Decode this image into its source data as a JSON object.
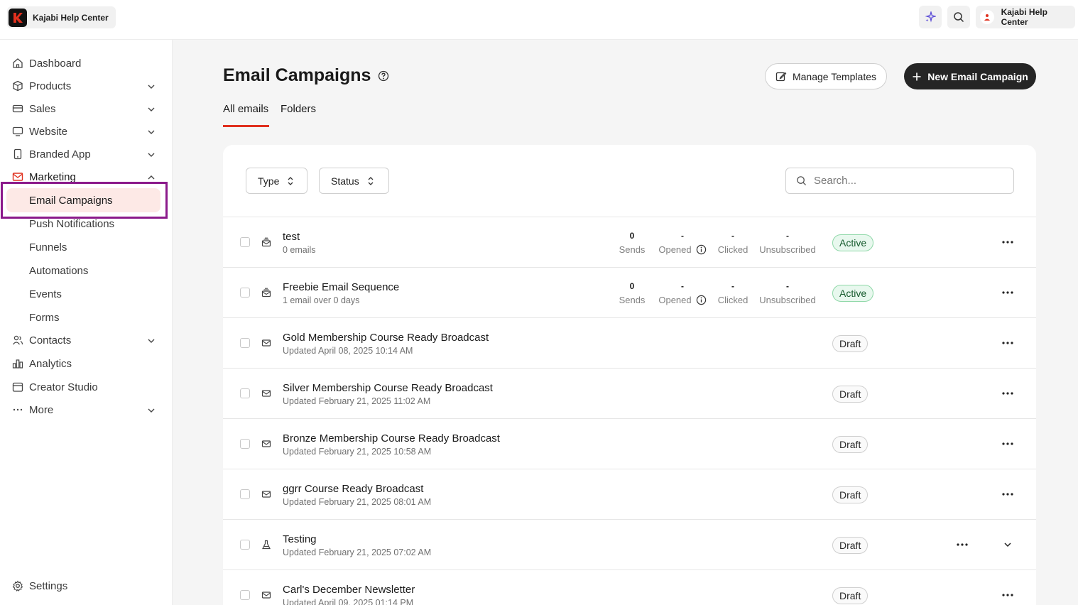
{
  "header": {
    "brand_name": "Kajabi Help Center",
    "account_name": "Kajabi Help Center",
    "icons": [
      "sparkle-icon",
      "search-icon",
      "avatar"
    ]
  },
  "sidebar": {
    "items": [
      {
        "label": "Dashboard",
        "icon": "home-icon"
      },
      {
        "label": "Products",
        "icon": "box-icon"
      },
      {
        "label": "Sales",
        "icon": "card-icon"
      },
      {
        "label": "Website",
        "icon": "monitor-icon"
      },
      {
        "label": "Branded App",
        "icon": "phone-icon"
      },
      {
        "label": "Marketing",
        "icon": "mail-icon"
      },
      {
        "label": "Contacts",
        "icon": "users-icon"
      },
      {
        "label": "Analytics",
        "icon": "bar-chart-icon"
      },
      {
        "label": "Creator Studio",
        "icon": "calendar-icon"
      },
      {
        "label": "More",
        "icon": "more-icon"
      }
    ],
    "marketing_sub": [
      "Email Campaigns",
      "Push Notifications",
      "Funnels",
      "Automations",
      "Events",
      "Forms"
    ],
    "settings_label": "Settings",
    "accent_color": "#e0301e",
    "active_bg": "#fde9e6",
    "highlight_color": "#8b1a8b"
  },
  "main": {
    "title": "Email Campaigns",
    "manage_templates": "Manage Templates",
    "new_campaign": "New Email Campaign",
    "tabs": [
      "All emails",
      "Folders"
    ],
    "filters": {
      "type": "Type",
      "status": "Status"
    },
    "search_placeholder": "Search...",
    "stat_labels": {
      "sends": "Sends",
      "opened": "Opened",
      "clicked": "Clicked",
      "unsubscribed": "Unsubscribed"
    },
    "rows": [
      {
        "title": "test",
        "subtitle": "0 emails",
        "type": "sequence",
        "status": "Active",
        "sends": "0",
        "opened": "-",
        "clicked": "-",
        "unsubscribed": "-"
      },
      {
        "title": "Freebie Email Sequence",
        "subtitle": "1 email over 0 days",
        "type": "sequence",
        "status": "Active",
        "sends": "0",
        "opened": "-",
        "clicked": "-",
        "unsubscribed": "-"
      },
      {
        "title": "Gold Membership Course Ready Broadcast",
        "subtitle": "Updated April 08, 2025 10:14 AM",
        "type": "broadcast",
        "status": "Draft"
      },
      {
        "title": "Silver Membership Course Ready Broadcast",
        "subtitle": "Updated February 21, 2025 11:02 AM",
        "type": "broadcast",
        "status": "Draft"
      },
      {
        "title": "Bronze Membership Course Ready Broadcast",
        "subtitle": "Updated February 21, 2025 10:58 AM",
        "type": "broadcast",
        "status": "Draft"
      },
      {
        "title": "ggrr Course Ready Broadcast",
        "subtitle": "Updated February 21, 2025 08:01 AM",
        "type": "broadcast",
        "status": "Draft"
      },
      {
        "title": "Testing",
        "subtitle": "Updated February 21, 2025 07:02 AM",
        "type": "ab-test",
        "status": "Draft"
      },
      {
        "title": "Carl's December Newsletter",
        "subtitle": "Updated April 09, 2025 01:14 PM",
        "type": "broadcast",
        "status": "Draft"
      }
    ]
  }
}
